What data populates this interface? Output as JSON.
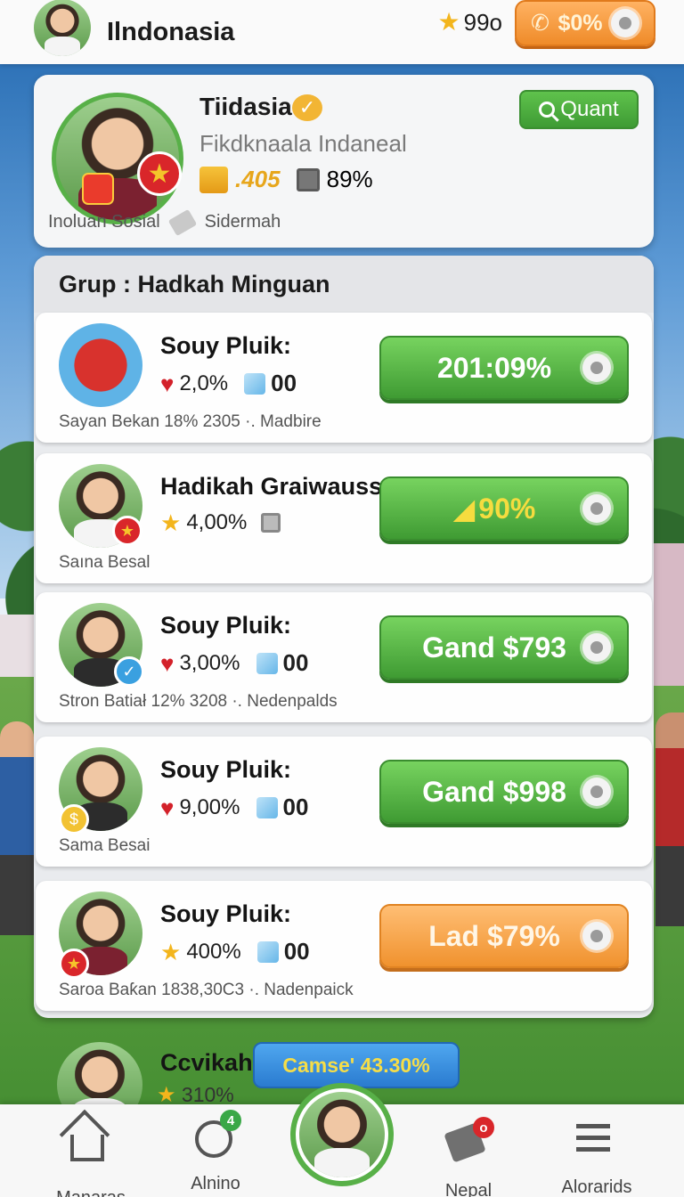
{
  "header": {
    "title": "Ilndonasia",
    "stars": "99o",
    "coin_button_label": "$0%"
  },
  "profile": {
    "name": "Tiidasia",
    "subtitle": "Fikdknaala Indaneal",
    "gold_count": ".405",
    "percent": "89%",
    "footer_left": "Inoluan Sosial",
    "footer_right": "Sidermah",
    "quant_button": "Quant"
  },
  "group": {
    "title": "Grup : Hadkah Minguan",
    "rows": [
      {
        "title": "Souy Pluik:",
        "stat1": "2,0%",
        "stat2": "00",
        "footer": "Sayan Bekan   18% 2305 ·. Madbire",
        "button": "201:09%"
      },
      {
        "title": "Hadikah Graiwauss",
        "stat1": "4,00%",
        "stat2": "",
        "footer": "Saına Besal",
        "button": "90%"
      },
      {
        "title": "Souy Pluik:",
        "stat1": "3,00%",
        "stat2": "00",
        "footer": "Stron Batiał   12% 3208 ·. Nedenpalds",
        "button": "Gand $793"
      },
      {
        "title": "Souy Pluik:",
        "stat1": "9,00%",
        "stat2": "00",
        "footer": "Sama Besai",
        "button": "Gand $998"
      },
      {
        "title": "Souy Pluik:",
        "stat1": "400%",
        "stat2": "00",
        "footer": "Saroa Baƙan   1838,30C3 ·. Nadenpaick",
        "button": "Lad $79%"
      }
    ]
  },
  "peek_row": {
    "title": "Ccvikah",
    "stat": "310%",
    "toast": "Camse' 43.30%"
  },
  "nav": {
    "items": [
      {
        "label": "Manaras",
        "icon": "home-icon"
      },
      {
        "label": "Alnino",
        "icon": "compass-icon",
        "badge": "4"
      },
      {
        "label": "Nepal",
        "icon": "tag-icon",
        "badge": "o"
      },
      {
        "label": "Alorarids",
        "icon": "menu-icon"
      }
    ]
  },
  "colors": {
    "accent_green": "#4caf3f",
    "accent_orange": "#f0922e",
    "toast_blue": "#2a7bd0"
  }
}
